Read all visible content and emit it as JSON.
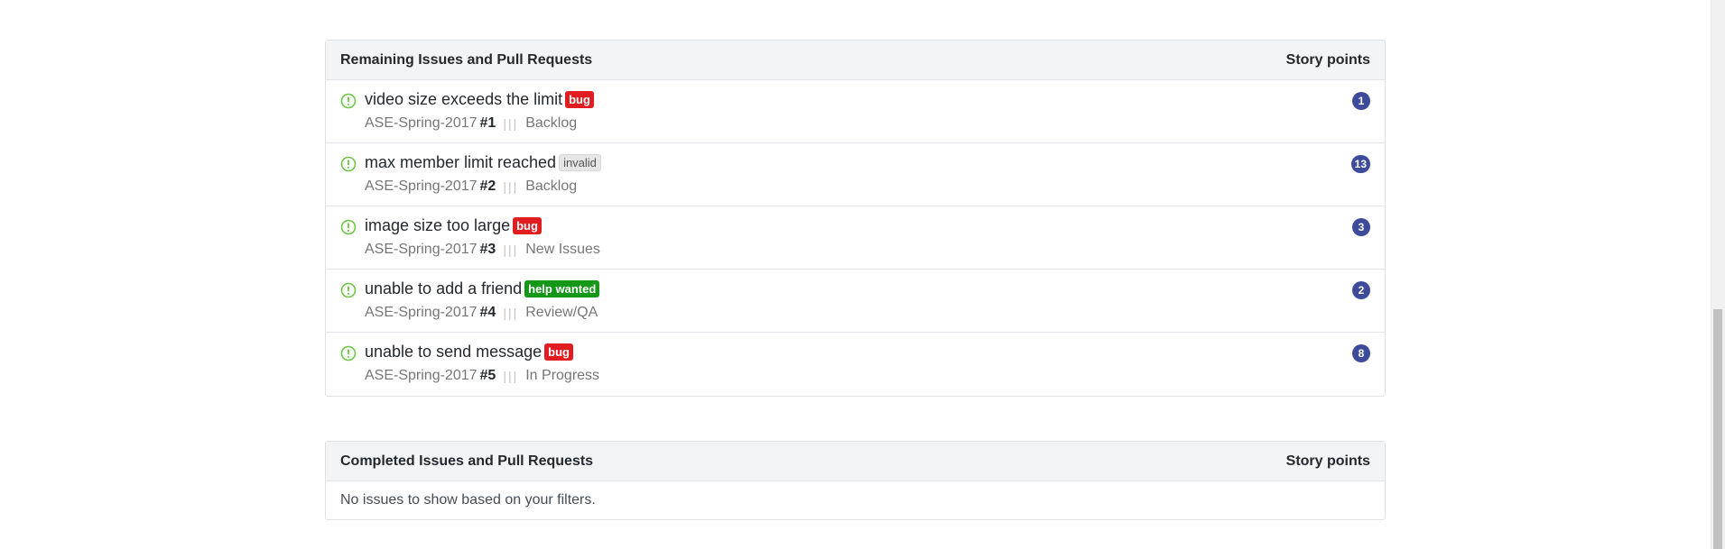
{
  "remaining": {
    "header_title": "Remaining Issues and Pull Requests",
    "header_points": "Story points",
    "issues": [
      {
        "title": "video size exceeds the limit",
        "label": "bug",
        "label_type": "bug",
        "repo": "ASE-Spring-2017",
        "number": "#1",
        "separator": "|||",
        "column": "Backlog",
        "points": "1"
      },
      {
        "title": "max member limit reached",
        "label": "invalid",
        "label_type": "invalid",
        "repo": "ASE-Spring-2017",
        "number": "#2",
        "separator": "|||",
        "column": "Backlog",
        "points": "13"
      },
      {
        "title": "image size too large",
        "label": "bug",
        "label_type": "bug",
        "repo": "ASE-Spring-2017",
        "number": "#3",
        "separator": "|||",
        "column": "New Issues",
        "points": "3"
      },
      {
        "title": "unable to add a friend",
        "label": "help wanted",
        "label_type": "help",
        "repo": "ASE-Spring-2017",
        "number": "#4",
        "separator": "|||",
        "column": "Review/QA",
        "points": "2"
      },
      {
        "title": "unable to send message",
        "label": "bug",
        "label_type": "bug",
        "repo": "ASE-Spring-2017",
        "number": "#5",
        "separator": "|||",
        "column": "In Progress",
        "points": "8"
      }
    ]
  },
  "completed": {
    "header_title": "Completed Issues and Pull Requests",
    "header_points": "Story points",
    "empty_text": "No issues to show based on your filters."
  },
  "icons": {
    "issue_icon": "issue-opened-icon"
  },
  "colors": {
    "issue_open": "#6cc644",
    "bug": "#e11d21",
    "help_wanted": "#159818",
    "invalid": "#e6e6e6",
    "points_badge": "#3e4b9b"
  }
}
